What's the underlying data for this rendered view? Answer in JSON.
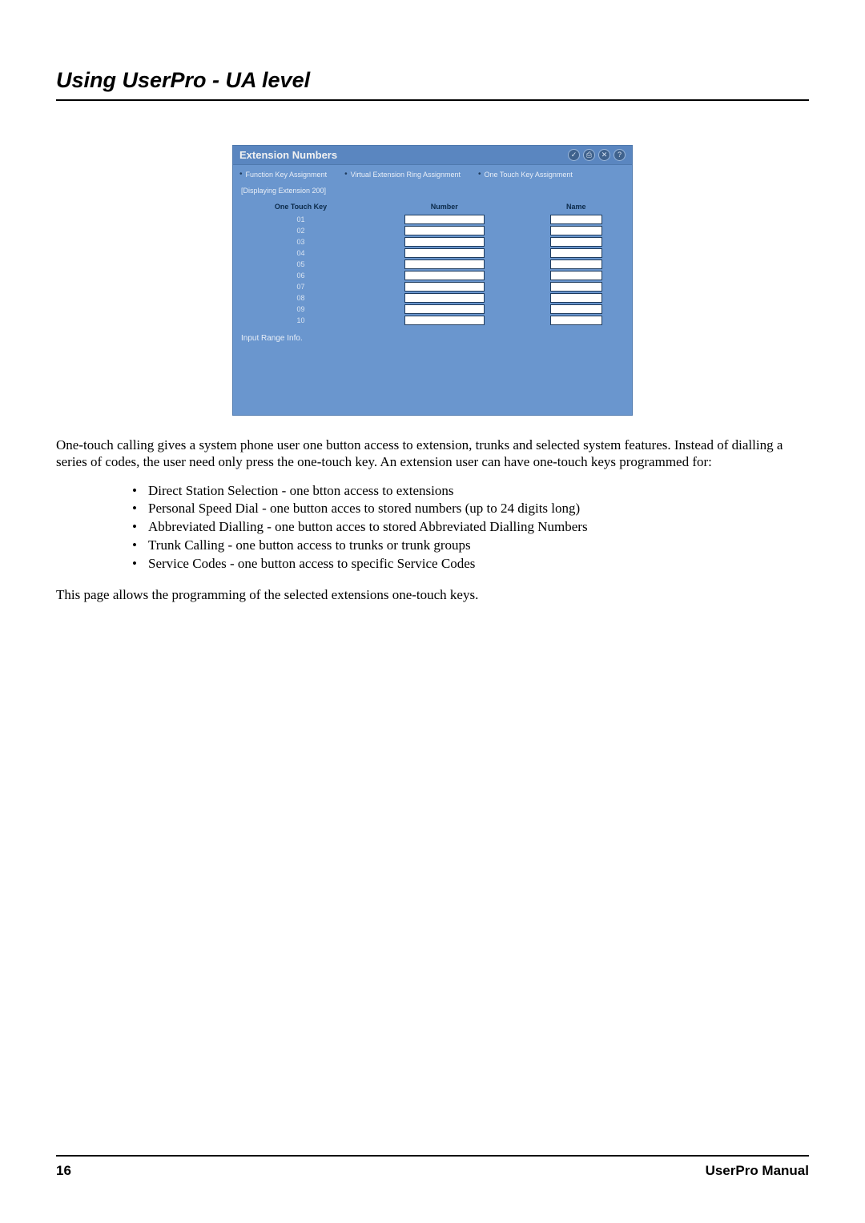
{
  "page_title": "Using UserPro - UA level",
  "panel": {
    "title": "Extension Numbers",
    "icons": {
      "check": "✓",
      "print": "⎙",
      "close": "✕",
      "help": "?"
    },
    "links": {
      "function_key": "Function Key Assignment",
      "virtual_ext": "Virtual Extension Ring Assignment",
      "one_touch": "One Touch Key Assignment"
    },
    "displaying": "[Displaying Extension 200]",
    "cols": {
      "key": "One Touch Key",
      "number": "Number",
      "name": "Name"
    },
    "rows": [
      {
        "key": "01",
        "number": "",
        "name": ""
      },
      {
        "key": "02",
        "number": "",
        "name": ""
      },
      {
        "key": "03",
        "number": "",
        "name": ""
      },
      {
        "key": "04",
        "number": "",
        "name": ""
      },
      {
        "key": "05",
        "number": "",
        "name": ""
      },
      {
        "key": "06",
        "number": "",
        "name": ""
      },
      {
        "key": "07",
        "number": "",
        "name": ""
      },
      {
        "key": "08",
        "number": "",
        "name": ""
      },
      {
        "key": "09",
        "number": "",
        "name": ""
      },
      {
        "key": "10",
        "number": "",
        "name": ""
      }
    ],
    "range_info": "Input Range Info."
  },
  "para1": "One-touch calling gives a system phone user one button access to extension, trunks and selected system features. Instead of dialling a series of codes, the user need only press the one-touch key. An extension user can have one-touch keys programmed for:",
  "bullets": [
    "Direct Station Selection - one btton access to extensions",
    "Personal Speed Dial - one button acces to stored numbers (up to 24 digits long)",
    "Abbreviated Dialling - one button acces to stored Abbreviated Dialling Numbers",
    "Trunk Calling - one button access to trunks or trunk groups",
    "Service Codes - one button access to specific Service Codes"
  ],
  "para2": "This page allows the programming of the selected extensions one-touch keys.",
  "footer": {
    "page": "16",
    "manual": "UserPro Manual"
  }
}
